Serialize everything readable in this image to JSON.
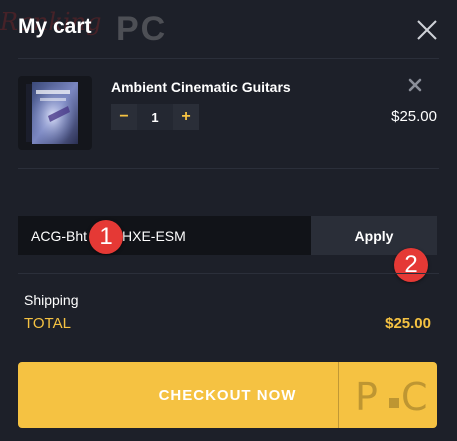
{
  "header": {
    "title": "My cart",
    "watermark_text": "Ranking",
    "watermark_logo": "PC",
    "close_icon": "close-icon"
  },
  "cart": {
    "items": [
      {
        "name": "Ambient Cinematic Guitars",
        "quantity": "1",
        "price": "$25.00",
        "decrement_label": "−",
        "increment_label": "+"
      }
    ]
  },
  "coupon": {
    "value": "ACG-Bht   HXE-ESM",
    "apply_label": "Apply"
  },
  "markers": [
    "1",
    "2"
  ],
  "summary": {
    "shipping_label": "Shipping",
    "total_label": "TOTAL",
    "total_value": "$25.00"
  },
  "checkout": {
    "label": "CHECKOUT NOW"
  },
  "colors": {
    "background": "#1d2029",
    "accent": "#f5c242",
    "marker": "#e53935"
  }
}
